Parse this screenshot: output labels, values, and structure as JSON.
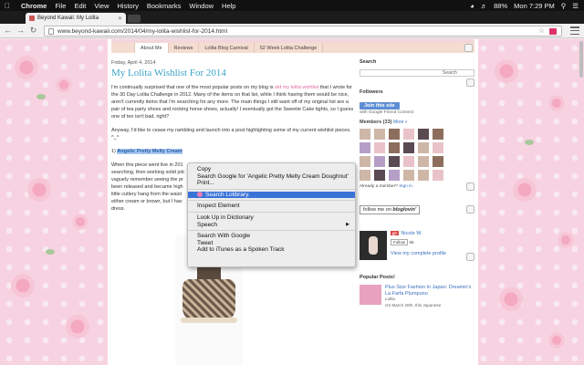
{
  "menubar": {
    "app": "Chrome",
    "items": [
      "File",
      "Edit",
      "View",
      "History",
      "Bookmarks",
      "Window",
      "Help"
    ],
    "battery": "88%",
    "clock": "Mon 7:29 PM"
  },
  "browser": {
    "tab_title": "Beyond Kawaii: My Lolita",
    "url": "www.beyond-kawaii.com/2014/04/my-lolita-wishlist-for-2014.html"
  },
  "blog": {
    "nav": [
      "",
      "About Me",
      "Reviews",
      "Lolita Blog Carnival",
      "52 Week Lolita Challenge"
    ],
    "post": {
      "date": "Friday, April 4, 2014",
      "title": "My Lolita Wishlist For 2014",
      "p1_a": "I'm continually surprised that one of the most popular posts on my blog is ",
      "p1_link": "old my lolita wishlist",
      "p1_b": " that I wrote for the 30 Day Lolita Challenge in 2012. Many of the items on that list, while I think having them would be nice, aren't currently items that I'm searching for any more. The main things I still want off of my original list are a pair of tea party shoes and rocking horse shoes, actually! I eventually got the Sweetie Cake tights, so I guess one of ten isn't bad, right?",
      "p2": "Anyway, I'd like to cease my rambling and launch into a post highlighting some of my current wishlist pieces. ^_^",
      "item_num": "1) ",
      "item_selected": "Angelic Pretty Melty Cream",
      "p3_lines": [
        "When this piece went live in 201",
        "searching, then working solid job",
        "vaguely remember seeing the pr",
        "been released and became high",
        "little cutlery hang from the waist",
        "either cream or brown, but I hav",
        "dress."
      ]
    },
    "sidebar": {
      "search_heading": "Search",
      "search_button": "Search",
      "followers_heading": "Followers",
      "join_label": "Join this site",
      "gfc_text": "with Google Friend Connect",
      "members_heading": "Members (33)",
      "members_more": "More »",
      "already_member": "Already a member?",
      "sign_in": "Sign in",
      "bloglovin_prefix": "follow me on",
      "bloglovin_brand": "bloglovin'",
      "profile_name": "Nicole W.",
      "gplus_badge": "g+",
      "follow_label": "Follow",
      "follow_count": "55",
      "view_profile": "View my complete profile",
      "popular_heading": "Popular Posts!",
      "popular_title": "Plus Size Fashion In Japan: Dreamin's La Farfa Plumpuno",
      "popular_excerpt_1": "Lolita",
      "popular_excerpt_2": "On March 20th, this Japanese"
    }
  },
  "context_menu": {
    "items": [
      {
        "label": "Copy",
        "group": 1
      },
      {
        "label": "Search Google for 'Angelic Pretty Melty Cream Doughnut'",
        "group": 1
      },
      {
        "label": "Print...",
        "group": 1
      },
      {
        "label": "Search Lolibrary.",
        "group": 2,
        "highlighted": true,
        "icon": "lolibrary-icon"
      },
      {
        "label": "Inspect Element",
        "group": 3
      },
      {
        "label": "Look Up in Dictionary",
        "group": 4
      },
      {
        "label": "Speech",
        "group": 4,
        "submenu": true
      },
      {
        "label": "Search With Google",
        "group": 5
      },
      {
        "label": "Tweet",
        "group": 5
      },
      {
        "label": "Add to iTunes as a Spoken Track",
        "group": 5
      }
    ]
  },
  "colors": {
    "title_blue": "#3aa4c9",
    "link_pink": "#e06aa0",
    "menu_highlight": "#3a73d8",
    "join_blue": "#5d8ed4"
  }
}
